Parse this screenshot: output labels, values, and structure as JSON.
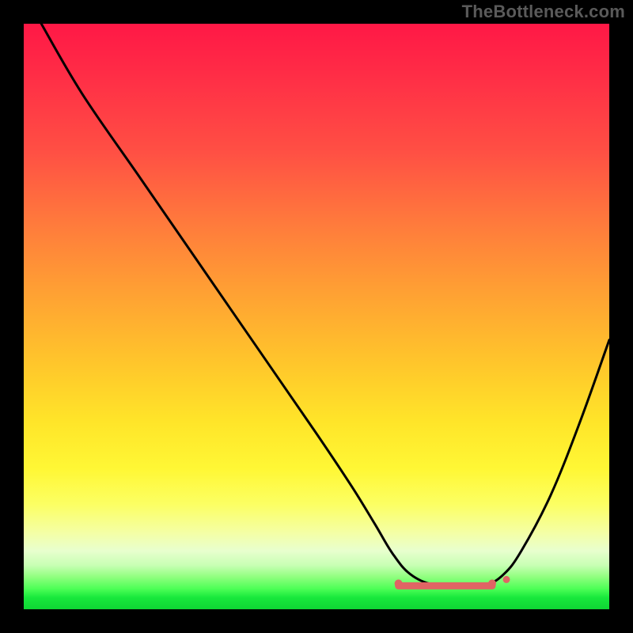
{
  "watermark": "TheBottleneck.com",
  "chart_data": {
    "type": "line",
    "title": "",
    "xlabel": "",
    "ylabel": "",
    "xlim": [
      0,
      100
    ],
    "ylim": [
      0,
      100
    ],
    "note": "Axes are unlabelled in source image; x and y expressed as percentages of plot width/height. y=0 at bottom, y=100 at top. Curve is a bottleneck V-shape with flat minimum near x≈65–80 at y≈4.",
    "series": [
      {
        "name": "bottleneck-curve",
        "x": [
          3,
          10,
          20,
          30,
          40,
          50,
          56,
          60,
          63,
          66,
          70,
          75,
          79,
          82,
          85,
          90,
          95,
          100
        ],
        "y": [
          100,
          88,
          73.5,
          59,
          44.5,
          30,
          21,
          14.5,
          9.5,
          6,
          4.2,
          4,
          4.2,
          6,
          10,
          19.5,
          32,
          46
        ]
      }
    ],
    "highlighted_range": {
      "name": "optimal-zone",
      "x_start": 64,
      "x_end": 80,
      "y": 4,
      "color": "#e06464"
    },
    "background_gradient": {
      "top": "#ff1846",
      "mid_upper": "#ff9a35",
      "mid": "#ffe529",
      "mid_lower": "#f4ffa6",
      "bottom": "#0fd634"
    }
  }
}
